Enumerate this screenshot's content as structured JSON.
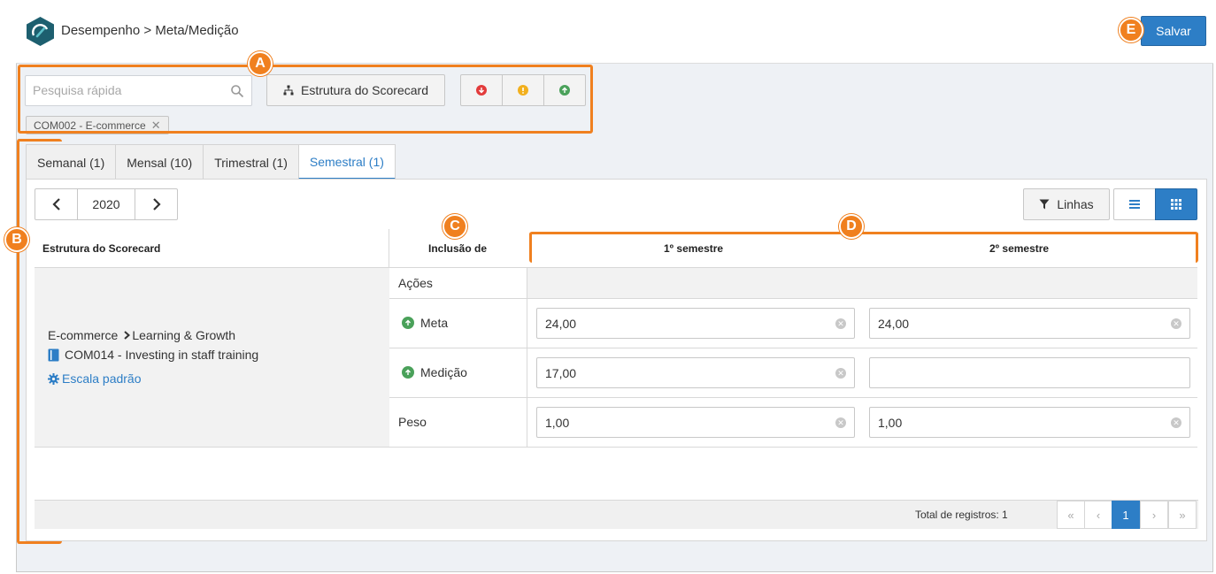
{
  "header": {
    "breadcrumb": "Desempenho > Meta/Medição",
    "save_label": "Salvar"
  },
  "toolbar": {
    "search_placeholder": "Pesquisa rápida",
    "scorecard_label": "Estrutura do Scorecard",
    "status_colors": {
      "red": "#e23b3b",
      "yellow": "#f2b01e",
      "green": "#4aa15a"
    },
    "filter_tag": "COM002 - E-commerce"
  },
  "tabs": [
    {
      "label": "Semanal (1)"
    },
    {
      "label": "Mensal (10)"
    },
    {
      "label": "Trimestral (1)"
    },
    {
      "label": "Semestral (1)",
      "active": true
    }
  ],
  "period": {
    "year": "2020"
  },
  "view": {
    "lines_label": "Linhas"
  },
  "table": {
    "headers": {
      "structure": "Estrutura do Scorecard",
      "inclusion": "Inclusão de",
      "semester1": "1º semestre",
      "semester2": "2º semestre"
    },
    "structure": {
      "path_root": "E-commerce",
      "path_child": "Learning & Growth",
      "indicator": "COM014 - Investing in staff training",
      "scale_link": "Escala padrão"
    },
    "rows": {
      "actions": "Ações",
      "meta": "Meta",
      "medicao": "Medição",
      "peso": "Peso"
    },
    "values": {
      "meta_s1": "24,00",
      "meta_s2": "24,00",
      "medicao_s1": "17,00",
      "medicao_s2": "",
      "peso_s1": "1,00",
      "peso_s2": "1,00"
    }
  },
  "footer": {
    "total_label": "Total de registros: 1",
    "pages": {
      "first": "«",
      "prev": "‹",
      "current": "1",
      "next": "›",
      "last": "»"
    }
  },
  "callouts": {
    "a": "A",
    "b": "B",
    "c": "C",
    "d": "D",
    "e": "E"
  }
}
